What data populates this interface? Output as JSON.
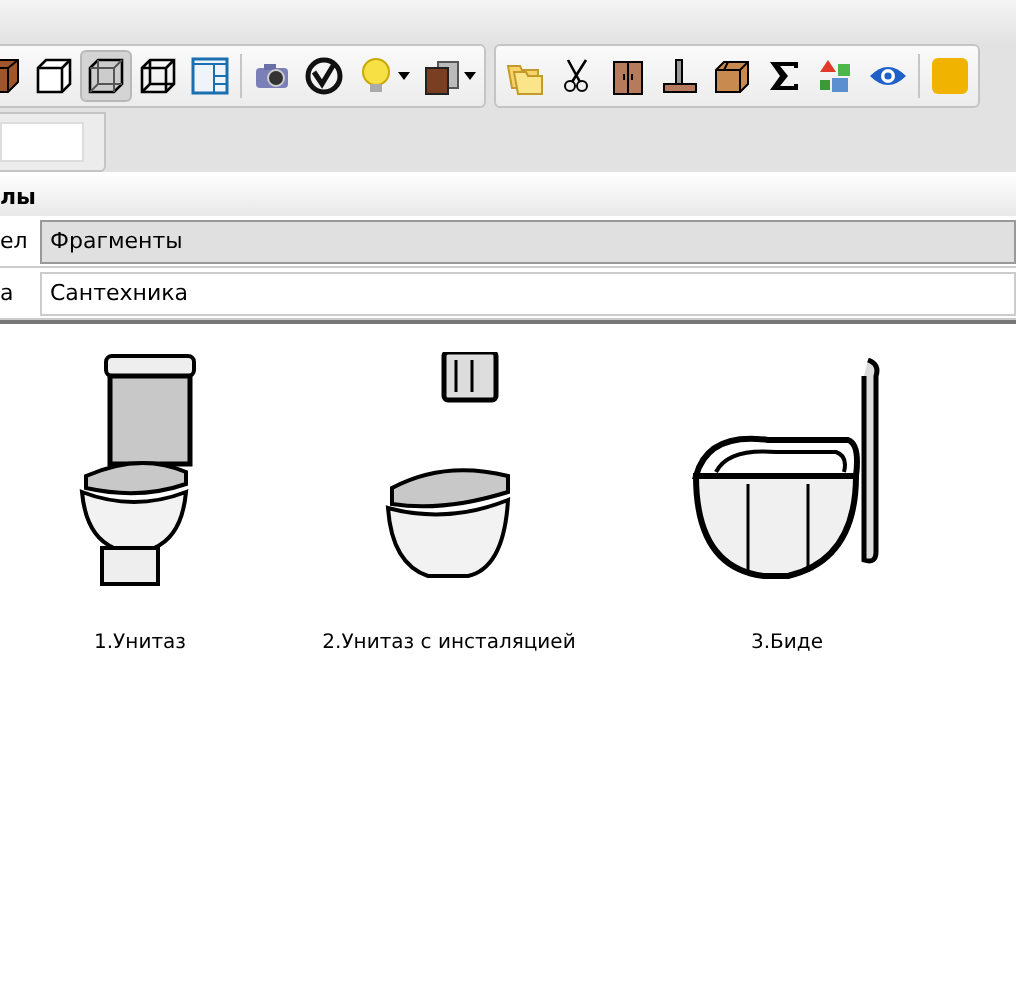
{
  "toolbars": [
    {
      "buttons": [
        {
          "pressed": false
        },
        {
          "pressed": false
        },
        {
          "pressed": true
        },
        {
          "pressed": false
        },
        {
          "pressed": false
        },
        {
          "pressed": false
        },
        {
          "pressed": false
        },
        {
          "pressed": false,
          "dropdown": true
        },
        {
          "pressed": false,
          "dropdown": true
        }
      ]
    },
    {
      "buttons": [
        {
          "pressed": false
        },
        {
          "pressed": false
        },
        {
          "pressed": false
        },
        {
          "pressed": false
        },
        {
          "pressed": false
        },
        {
          "pressed": false
        },
        {
          "pressed": false
        },
        {
          "pressed": false
        },
        {
          "pressed": false
        }
      ]
    }
  ],
  "panel": {
    "header": "лы",
    "section": {
      "label": "ел",
      "value": "Фрагменты"
    },
    "group": {
      "label": "а",
      "value": "Сантехника"
    }
  },
  "items": [
    {
      "kind": "floor-toilet",
      "label": "1.Унитаз"
    },
    {
      "kind": "wall-toilet",
      "label": "2.Унитаз с инсталяцией"
    },
    {
      "kind": "bidet",
      "label": "3.Биде"
    }
  ]
}
